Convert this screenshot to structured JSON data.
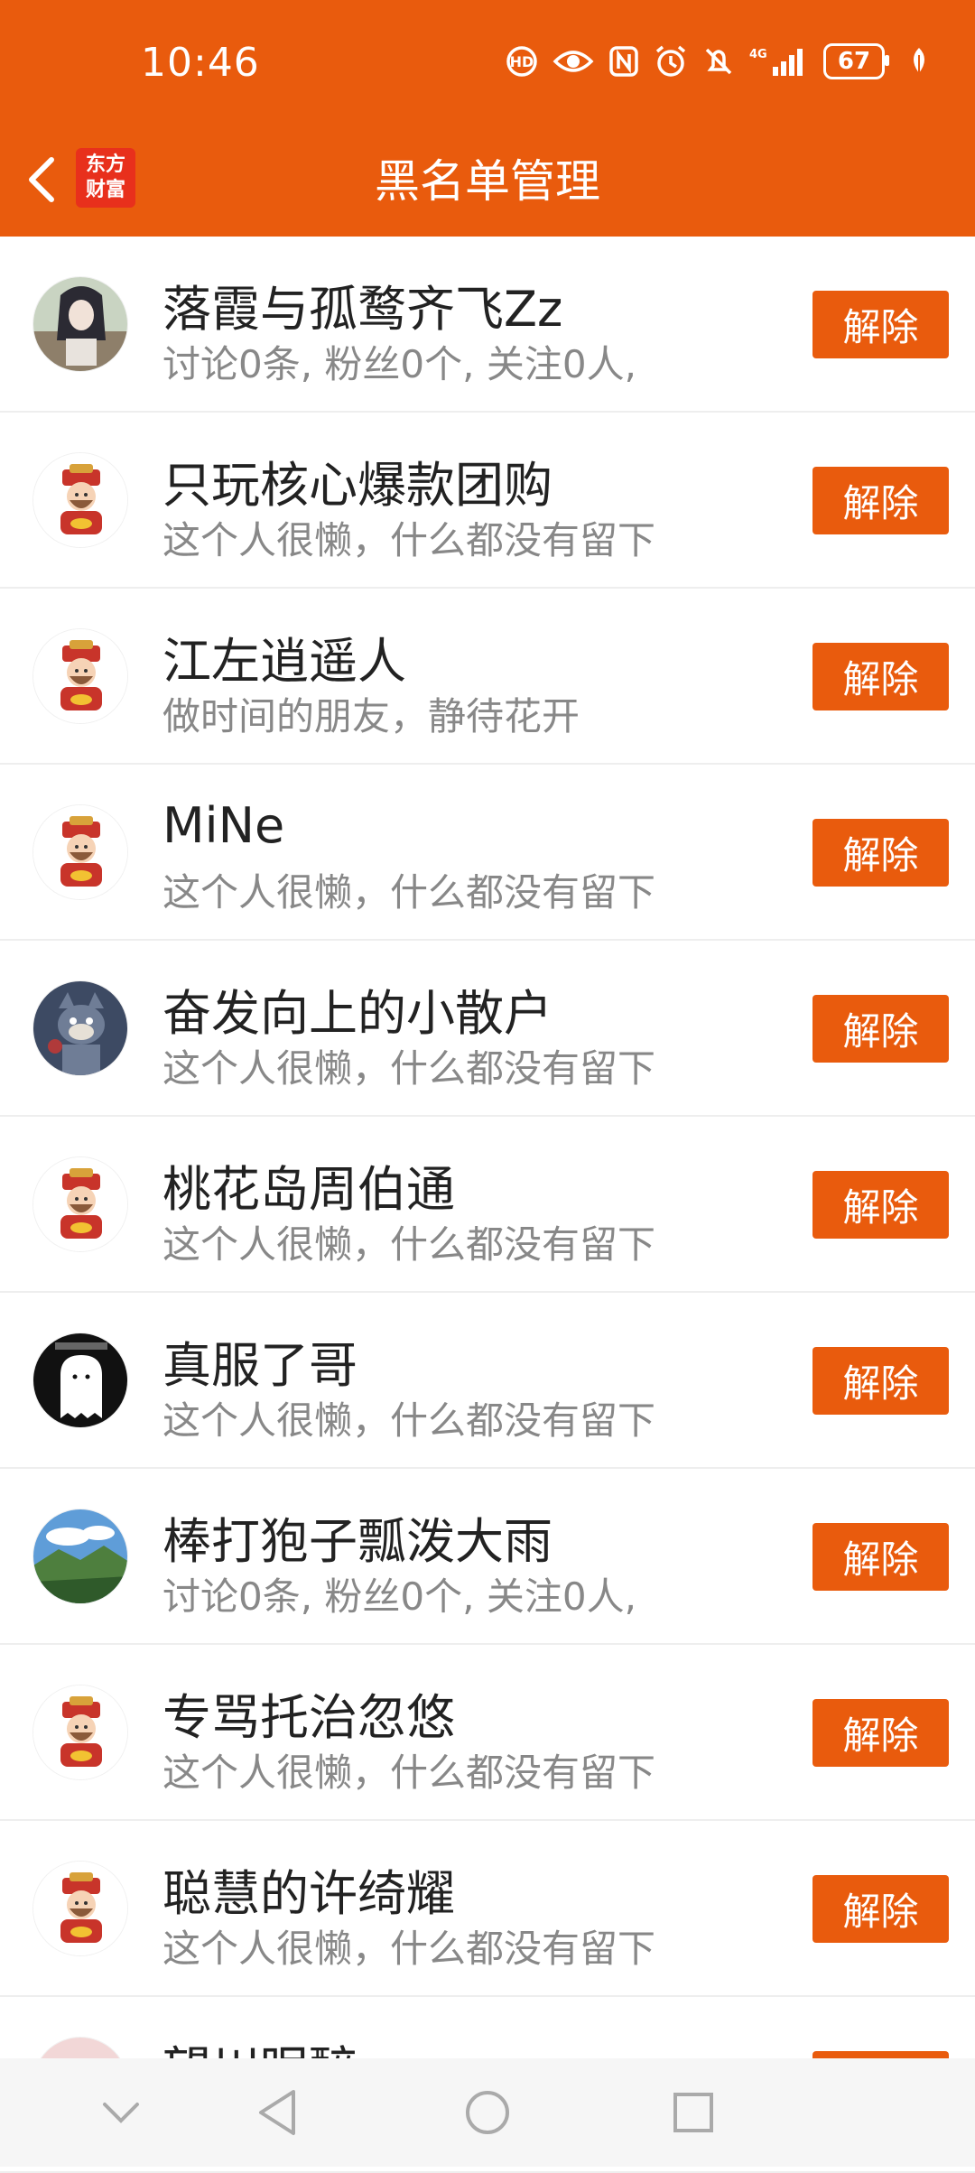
{
  "status_bar": {
    "time": "10:46",
    "battery": "67",
    "network": "4G",
    "icons": [
      "hd-icon",
      "eye-icon",
      "nfc-icon",
      "alarm-icon",
      "mute-icon",
      "signal-icon",
      "battery-icon",
      "leaf-icon"
    ]
  },
  "header": {
    "title": "黑名单管理",
    "logo_line1": "东方",
    "logo_line2": "财富"
  },
  "colors": {
    "brand": "#E95B0D",
    "logo_red": "#E8301C"
  },
  "button_label": "解除",
  "rows": [
    {
      "name": "落霞与孤鹜齐飞Zz",
      "desc": "讨论0条, 粉丝0个, 关注0人,",
      "avatar": "anime-girl-avatar"
    },
    {
      "name": "只玩核心爆款团购",
      "desc": "这个人很懒，什么都没有留下",
      "avatar": "god-of-wealth-avatar"
    },
    {
      "name": "江左逍遥人",
      "desc": "做时间的朋友，静待花开",
      "avatar": "god-of-wealth-avatar"
    },
    {
      "name": "MiNe",
      "desc": "这个人很懒，什么都没有留下",
      "avatar": "god-of-wealth-avatar"
    },
    {
      "name": "奋发向上的小散户",
      "desc": "这个人很懒，什么都没有留下",
      "avatar": "cartoon-cat-avatar"
    },
    {
      "name": "桃花岛周伯通",
      "desc": "这个人很懒，什么都没有留下",
      "avatar": "god-of-wealth-avatar"
    },
    {
      "name": "真服了哥",
      "desc": "这个人很懒，什么都没有留下",
      "avatar": "ghost-avatar"
    },
    {
      "name": "棒打狍子瓢泼大雨",
      "desc": "讨论0条, 粉丝0个, 关注0人,",
      "avatar": "landscape-avatar"
    },
    {
      "name": "专骂托治忽悠",
      "desc": "这个人很懒，什么都没有留下",
      "avatar": "god-of-wealth-avatar"
    },
    {
      "name": "聪慧的许绮耀",
      "desc": "这个人很懒，什么都没有留下",
      "avatar": "god-of-wealth-avatar"
    },
    {
      "name": "望川眠醉",
      "desc": "",
      "avatar": "partial-avatar"
    }
  ],
  "nav_bar": {
    "items": [
      "chevron-down-icon",
      "back-triangle-icon",
      "home-circle-icon",
      "recents-square-icon"
    ]
  }
}
